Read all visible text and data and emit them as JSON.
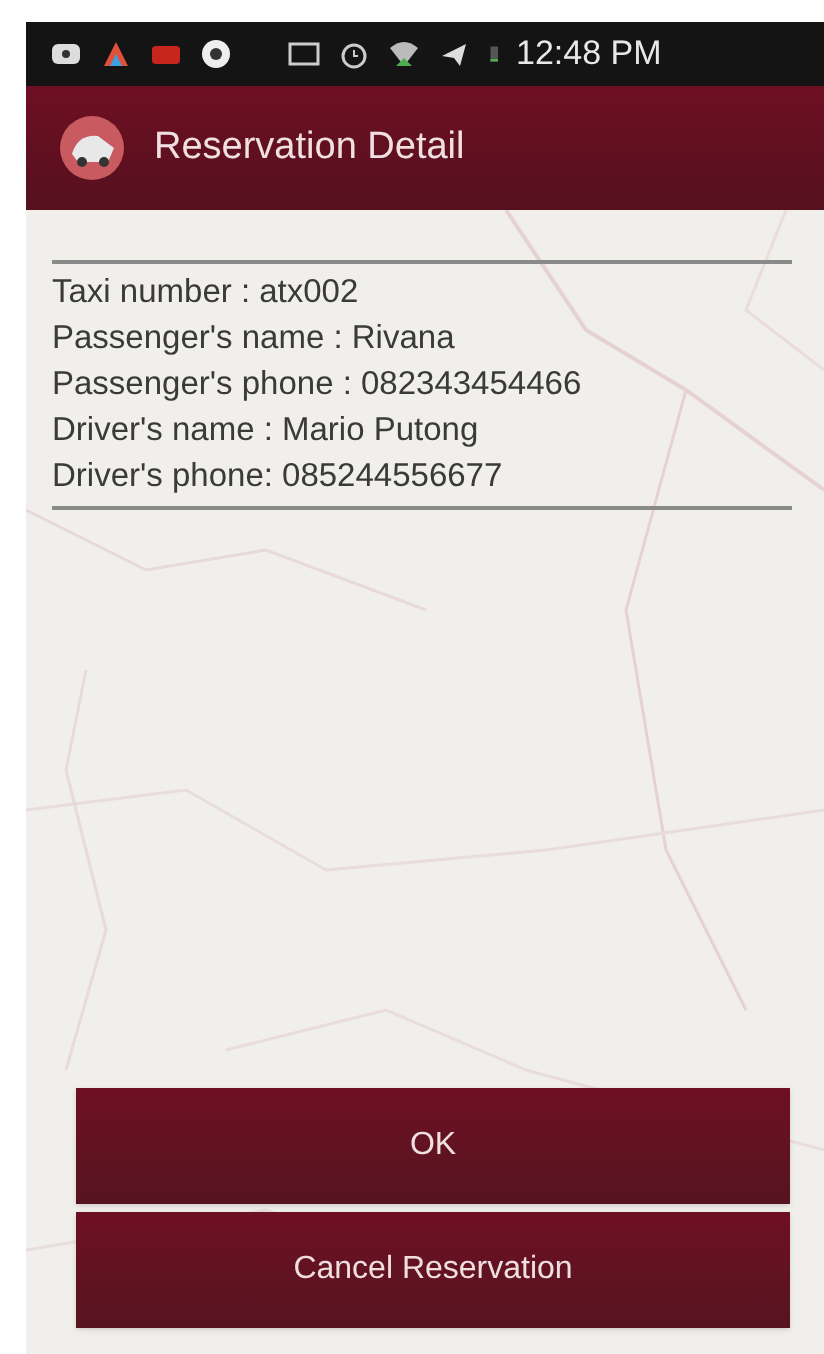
{
  "status_bar": {
    "time": "12:48 PM"
  },
  "app_bar": {
    "title": "Reservation Detail"
  },
  "details": [
    "Taxi number : atx002",
    "Passenger's name : Rivana",
    "Passenger's phone : 082343454466",
    "Driver's name : Mario Putong",
    "Driver's phone: 085244556677"
  ],
  "buttons": [
    "OK",
    "Cancel Reservation"
  ]
}
